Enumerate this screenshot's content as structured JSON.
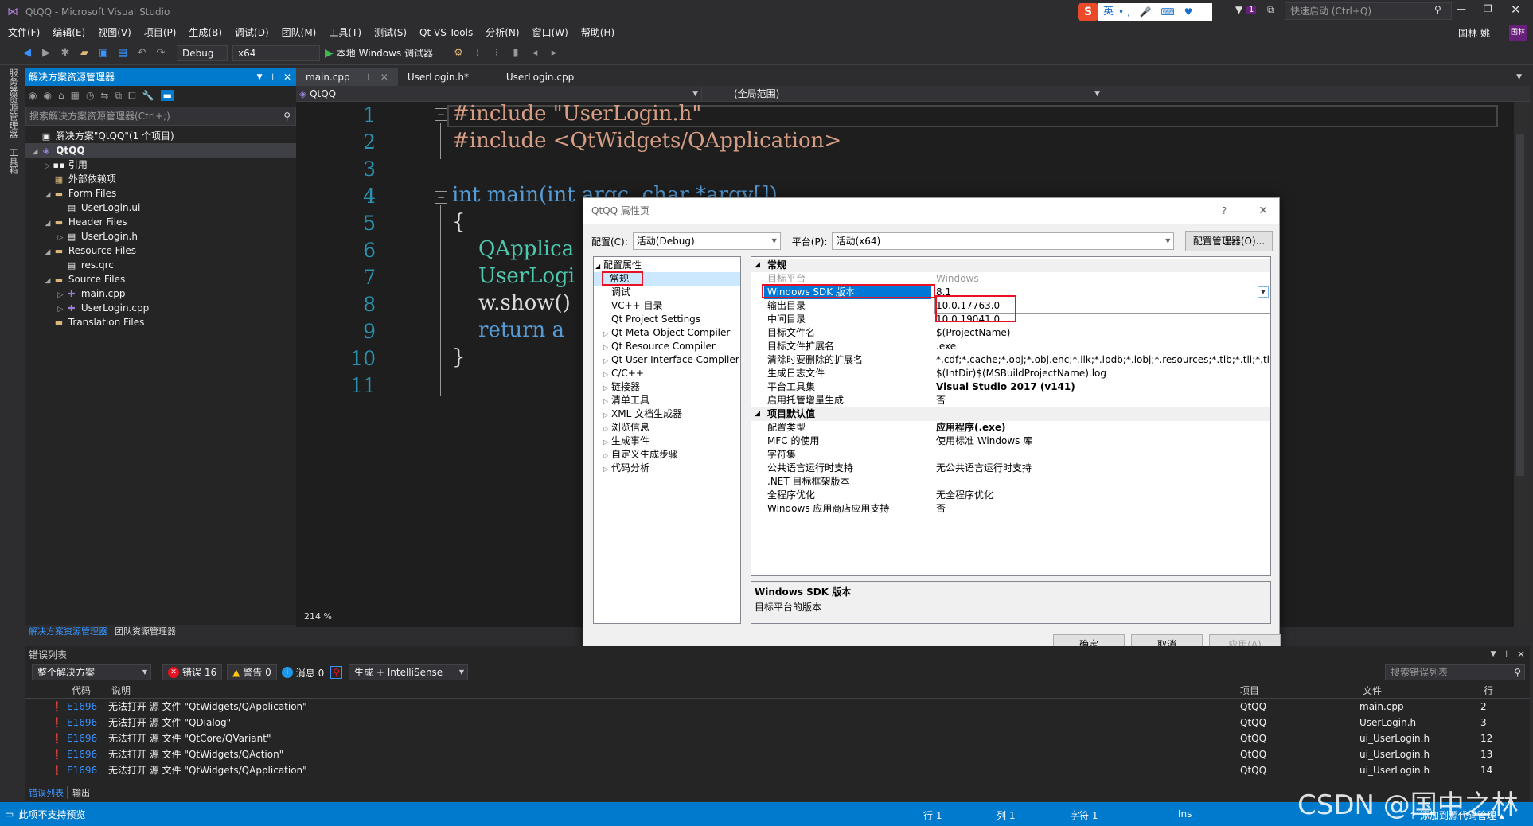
{
  "title": "QtQQ - Microsoft Visual Studio",
  "ime": {
    "logo": "S",
    "lang": "英"
  },
  "quick_launch": "快速启动 (Ctrl+Q)",
  "notify_count": "1",
  "user": "国林 姚",
  "user_initials": "国林",
  "menu": [
    "文件(F)",
    "编辑(E)",
    "视图(V)",
    "项目(P)",
    "生成(B)",
    "调试(D)",
    "团队(M)",
    "工具(T)",
    "测试(S)",
    "Qt VS Tools",
    "分析(N)",
    "窗口(W)",
    "帮助(H)"
  ],
  "toolbar": {
    "config": "Debug",
    "platform": "x64",
    "run": "本地 Windows 调试器"
  },
  "left_strip": [
    "服务器资源管理器",
    "工具箱"
  ],
  "solution_explorer": {
    "title": "解决方案资源管理器",
    "search_placeholder": "搜索解决方案资源管理器(Ctrl+;)",
    "items": [
      {
        "label": "解决方案\"QtQQ\"(1 个项目)",
        "arrow": "",
        "icon": "▣"
      },
      {
        "label": "QtQQ",
        "arrow": "◢",
        "icon": "◈"
      },
      {
        "label": "引用",
        "arrow": "▷",
        "icon": "▪▪"
      },
      {
        "label": "外部依赖项",
        "arrow": "",
        "icon": "▦"
      },
      {
        "label": "Form Files",
        "arrow": "◢",
        "icon": "▬"
      },
      {
        "label": "UserLogin.ui",
        "arrow": "",
        "icon": "▤"
      },
      {
        "label": "Header Files",
        "arrow": "◢",
        "icon": "▬"
      },
      {
        "label": "UserLogin.h",
        "arrow": "▷",
        "icon": "▤"
      },
      {
        "label": "Resource Files",
        "arrow": "◢",
        "icon": "▬"
      },
      {
        "label": "res.qrc",
        "arrow": "",
        "icon": "▤"
      },
      {
        "label": "Source Files",
        "arrow": "◢",
        "icon": "▬"
      },
      {
        "label": "main.cpp",
        "arrow": "▷",
        "icon": "✚"
      },
      {
        "label": "UserLogin.cpp",
        "arrow": "▷",
        "icon": "✚"
      },
      {
        "label": "Translation Files",
        "arrow": "",
        "icon": "▬"
      }
    ],
    "bottom_tabs": [
      "解决方案资源管理器",
      "团队资源管理器"
    ]
  },
  "editor": {
    "tabs": [
      "main.cpp",
      "UserLogin.h*",
      "UserLogin.cpp"
    ],
    "scope_left": "QtQQ",
    "scope_right": "(全局范围)",
    "zoom": "214 %",
    "line_numbers": [
      "1",
      "2",
      "3",
      "4",
      "5",
      "6",
      "7",
      "8",
      "9",
      "10",
      "11"
    ],
    "code": [
      "#include \"UserLogin.h\"",
      "#include <QtWidgets/QApplication>",
      "",
      "int main(int argc, char *argv[])",
      "{",
      "    QApplica",
      "    UserLogi",
      "    w.show()",
      "    return a",
      "}",
      ""
    ]
  },
  "dialog": {
    "title": "QtQQ 属性页",
    "help": "?",
    "close": "✕",
    "config_label": "配置(C):",
    "config_value": "活动(Debug)",
    "platform_label": "平台(P):",
    "platform_value": "活动(x64)",
    "config_manager": "配置管理器(O)...",
    "tree": [
      {
        "label": "配置属性",
        "arrow": "◢"
      },
      {
        "label": "常规",
        "arrow": ""
      },
      {
        "label": "调试",
        "arrow": ""
      },
      {
        "label": "VC++ 目录",
        "arrow": ""
      },
      {
        "label": "Qt Project Settings",
        "arrow": ""
      },
      {
        "label": "Qt Meta-Object Compiler",
        "arrow": "▷"
      },
      {
        "label": "Qt Resource Compiler",
        "arrow": "▷"
      },
      {
        "label": "Qt User Interface Compiler",
        "arrow": "▷"
      },
      {
        "label": "C/C++",
        "arrow": "▷"
      },
      {
        "label": "链接器",
        "arrow": "▷"
      },
      {
        "label": "清单工具",
        "arrow": "▷"
      },
      {
        "label": "XML 文档生成器",
        "arrow": "▷"
      },
      {
        "label": "浏览信息",
        "arrow": "▷"
      },
      {
        "label": "生成事件",
        "arrow": "▷"
      },
      {
        "label": "自定义生成步骤",
        "arrow": "▷"
      },
      {
        "label": "代码分析",
        "arrow": "▷"
      }
    ],
    "grid": {
      "cat_general": "常规",
      "rows": [
        {
          "name": "目标平台",
          "value": "Windows"
        },
        {
          "name": "Windows SDK 版本",
          "value": "8.1"
        },
        {
          "name": "输出目录",
          "value": "10.0.17763.0"
        },
        {
          "name": "中间目录",
          "value": "10.0.19041.0"
        },
        {
          "name": "目标文件名",
          "value": "$(ProjectName)"
        },
        {
          "name": "目标文件扩展名",
          "value": ".exe"
        },
        {
          "name": "清除时要删除的扩展名",
          "value": "*.cdf;*.cache;*.obj;*.obj.enc;*.ilk;*.ipdb;*.iobj;*.resources;*.tlb;*.tli;*.tlh;*.tmp"
        },
        {
          "name": "生成日志文件",
          "value": "$(IntDir)$(MSBuildProjectName).log"
        },
        {
          "name": "平台工具集",
          "value": "Visual Studio 2017 (v141)"
        },
        {
          "name": "启用托管增量生成",
          "value": "否"
        }
      ],
      "cat_defaults": "项目默认值",
      "rows2": [
        {
          "name": "配置类型",
          "value": "应用程序(.exe)"
        },
        {
          "name": "MFC 的使用",
          "value": "使用标准 Windows 库"
        },
        {
          "name": "字符集",
          "value": ""
        },
        {
          "name": "公共语言运行时支持",
          "value": "无公共语言运行时支持"
        },
        {
          "name": ".NET 目标框架版本",
          "value": ""
        },
        {
          "name": "全程序优化",
          "value": "无全程序优化"
        },
        {
          "name": "Windows 应用商店应用支持",
          "value": "否"
        }
      ]
    },
    "desc_title": "Windows SDK 版本",
    "desc_text": "目标平台的版本",
    "ok": "确定",
    "cancel": "取消",
    "apply": "应用(A)"
  },
  "error_list": {
    "title": "错误列表",
    "scope": "整个解决方案",
    "errors_badge": "错误 16",
    "warnings_badge": "警告 0",
    "messages_badge": "消息 0",
    "build_filter": "生成 + IntelliSense",
    "search_placeholder": "搜索错误列表",
    "headers": [
      "代码",
      "说明",
      "项目",
      "文件",
      "行"
    ],
    "rows": [
      {
        "code": "E1696",
        "desc": "无法打开 源 文件 \"QtWidgets/QApplication\"",
        "project": "QtQQ",
        "file": "main.cpp",
        "line": "2"
      },
      {
        "code": "E1696",
        "desc": "无法打开 源 文件 \"QDialog\"",
        "project": "QtQQ",
        "file": "UserLogin.h",
        "line": "3"
      },
      {
        "code": "E1696",
        "desc": "无法打开 源 文件 \"QtCore/QVariant\"",
        "project": "QtQQ",
        "file": "ui_UserLogin.h",
        "line": "12"
      },
      {
        "code": "E1696",
        "desc": "无法打开 源 文件 \"QtWidgets/QAction\"",
        "project": "QtQQ",
        "file": "ui_UserLogin.h",
        "line": "13"
      },
      {
        "code": "E1696",
        "desc": "无法打开 源 文件 \"QtWidgets/QApplication\"",
        "project": "QtQQ",
        "file": "ui_UserLogin.h",
        "line": "14"
      }
    ],
    "bottom_tabs": [
      "错误列表",
      "输出"
    ]
  },
  "status": {
    "left": "此项不支持预览",
    "row": "行 1",
    "col": "列 1",
    "char": "字符 1",
    "ins": "Ins",
    "source": "↑ 添加到源代码管理 ▴"
  },
  "watermark": "CSDN @国中之林",
  "colors": {
    "accent": "#007acc",
    "error": "#e81123",
    "link": "#3794ff"
  }
}
